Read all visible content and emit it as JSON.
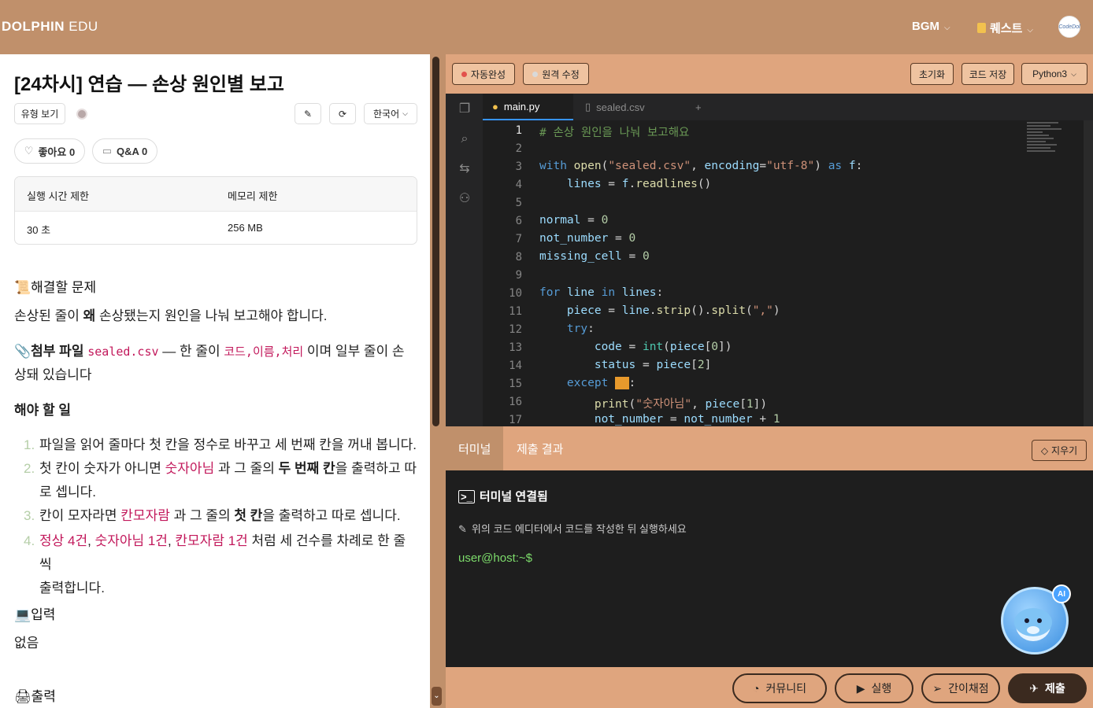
{
  "app": {
    "brand_bold": "DOLPHIN",
    "brand_light": "EDU",
    "bgm_label": "BGM",
    "quest_label": "퀘스트",
    "avatar_text": "CodeDol"
  },
  "problem": {
    "title": "[24차시] 연습 — 손상 원인별 보고",
    "type_button": "유형 보기",
    "language": "한국어",
    "like_label": "좋아요 0",
    "qa_label": "Q&A 0",
    "limits": {
      "time_header": "실행 시간 제한",
      "memory_header": "메모리 제한",
      "time_value": "30 초",
      "memory_value": "256 MB"
    },
    "section_problem": "해결할 문제",
    "problem_text_pre": "손상된 줄이 ",
    "problem_text_bold": "왜",
    "problem_text_post": " 손상됐는지 원인을 나눠 보고해야 합니다.",
    "attach_label": "첨부 파일",
    "attach_file": "sealed.csv",
    "attach_mid": " — 한 줄이 ",
    "attach_format": "코드,이름,처리",
    "attach_post_1": " 이며 일부 줄이 손",
    "attach_post_2": "상돼 있습니다",
    "todo_title": "해야 할 일",
    "todo": [
      {
        "num": "1.",
        "line1": "파일을 읽어 줄마다 첫 칸을 정수로 바꾸고 세 번째 칸을 꺼내 봅니다."
      },
      {
        "num": "2.",
        "pre": "첫 칸이 숫자가 아니면 ",
        "red": "숫자아님",
        "mid": " 과 그 줄의 ",
        "bold": "두 번째 칸",
        "post": "을 출력하고 따",
        "line2": "로 셉니다."
      },
      {
        "num": "3.",
        "pre": "칸이 모자라면 ",
        "red": "칸모자람",
        "mid": " 과 그 줄의 ",
        "bold": "첫 칸",
        "post": "을 출력하고 따로 셉니다."
      },
      {
        "num": "4.",
        "red1": "정상  4건",
        "sep1": ", ",
        "red2": "숫자아님  1건",
        "sep2": ", ",
        "red3": "칸모자람  1건",
        "post": " 처럼 세 건수를 차례로 한 줄씩",
        "line2": "출력합니다."
      }
    ],
    "section_input": "입력",
    "input_text": "없음",
    "section_output": "출력"
  },
  "editor_toolbar": {
    "autocomplete": "자동완성",
    "remote_edit": "원격 수정",
    "reset": "초기화",
    "save": "코드 저장",
    "language": "Python3"
  },
  "editor": {
    "tabs": [
      "main.py",
      "sealed.csv"
    ],
    "add_tab": "+",
    "line_numbers": [
      "1",
      "2",
      "3",
      "4",
      "5",
      "6",
      "7",
      "8",
      "9",
      "10",
      "11",
      "12",
      "13",
      "14",
      "15",
      "16",
      "17"
    ]
  },
  "terminal": {
    "tab_terminal": "터미널",
    "tab_result": "제출 결과",
    "clear": "지우기",
    "connected": "터미널 연결됨",
    "hint": "위의 코드 에디터에서 코드를 작성한 뒤 실행하세요",
    "prompt": "user@host:~$",
    "ai_badge": "AI"
  },
  "actions": {
    "community": "커뮤니티",
    "run": "실행",
    "quick_grade": "간이채점",
    "submit": "제출"
  },
  "colors": {
    "brand_bg": "#c0906b",
    "toolbar_bg": "#dfa57e",
    "editor_bg": "#1e1e1e",
    "accent_red": "#c2185b"
  }
}
